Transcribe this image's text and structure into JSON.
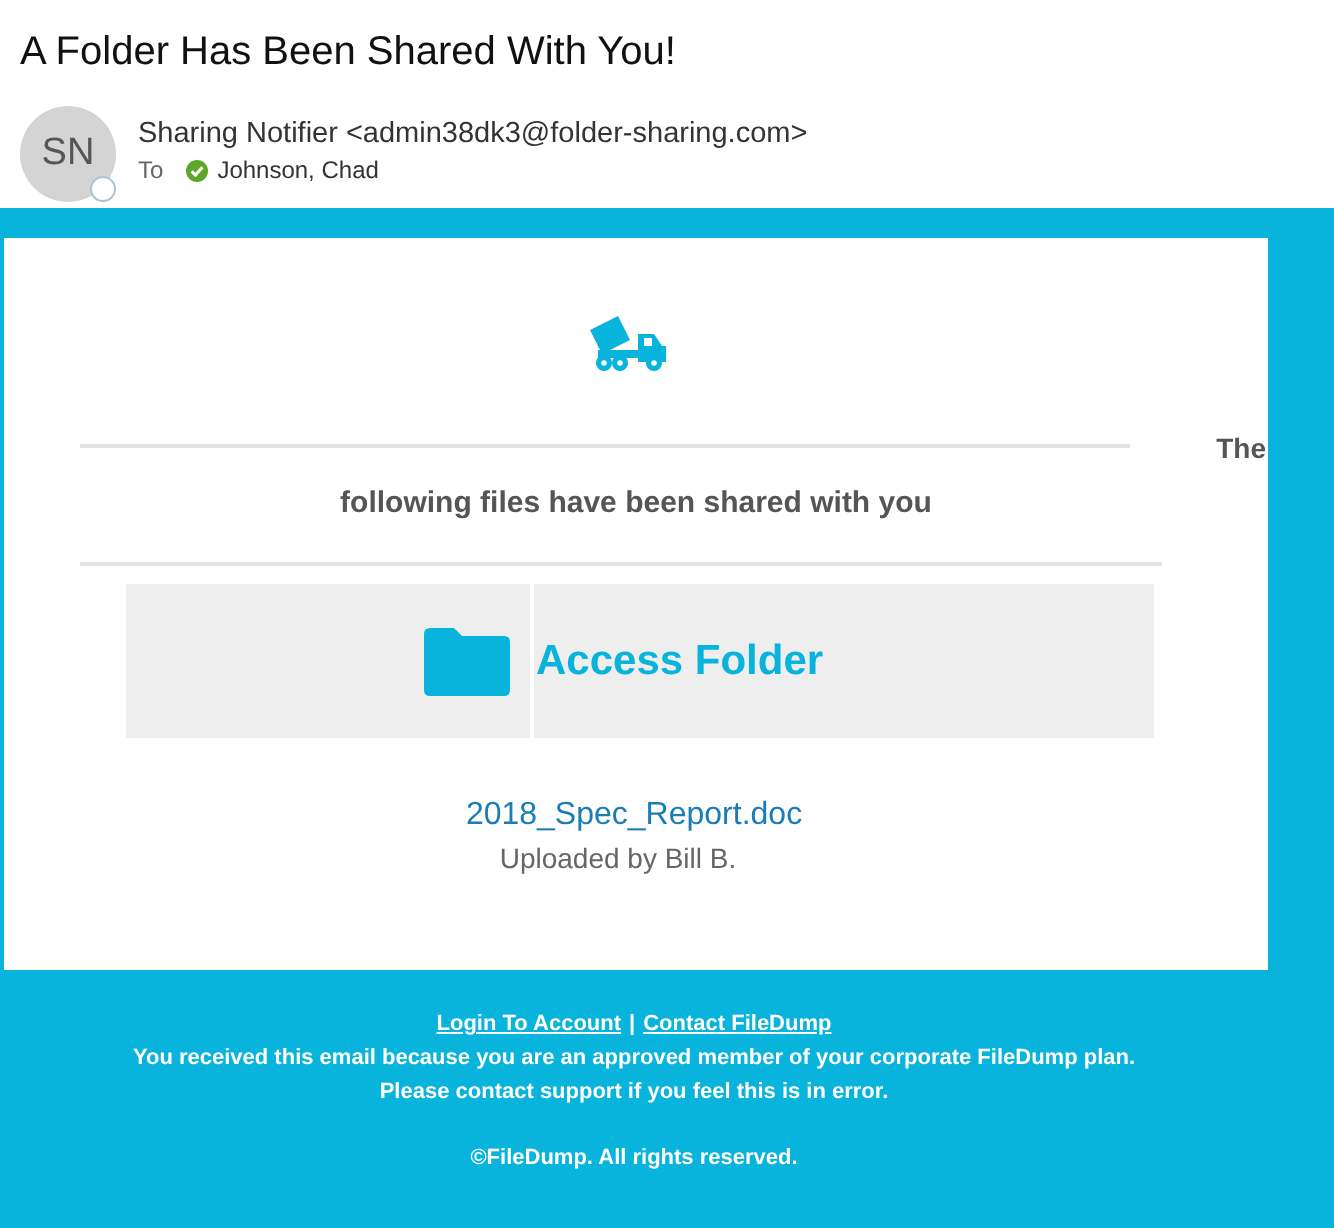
{
  "email": {
    "subject": "A Folder Has Been Shared With You!",
    "avatar_initials": "SN",
    "sender": "Sharing Notifier <admin38dk3@folder-sharing.com>",
    "to_label": "To",
    "recipient": "Johnson, Chad"
  },
  "message": {
    "intro_fragment": "The",
    "heading": "following files have been shared with you",
    "action_button": {
      "label": "Access Folder"
    },
    "file": {
      "name": "2018_Spec_Report.doc",
      "uploaded_by": "Uploaded by Bill B."
    }
  },
  "footer": {
    "links": [
      "Login To Account",
      "Contact FileDump"
    ],
    "separator": "|",
    "notice_lines": [
      "You received this email because you are an approved member of your corporate FileDump plan.",
      "Please contact support if you feel this is in error."
    ],
    "copyright": "©FileDump. All rights reserved."
  }
}
